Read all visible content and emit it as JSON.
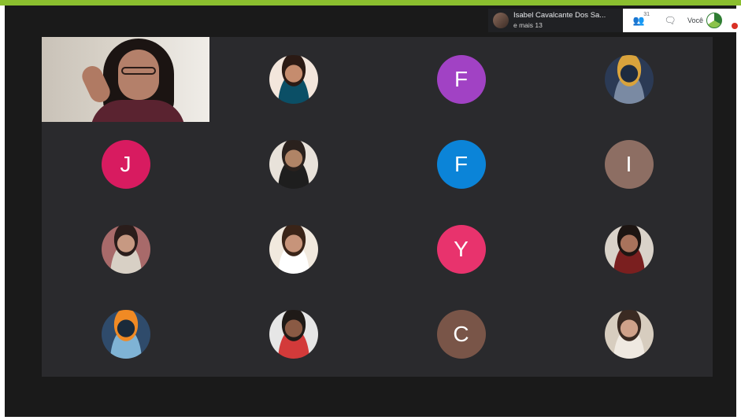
{
  "header": {
    "presenter_name": "Isabel Cavalcante Dos Sa...",
    "presenter_more": "e mais 13",
    "participants_count": "31",
    "you_label": "Você"
  },
  "participants": [
    {
      "type": "video",
      "name": "Presenter video"
    },
    {
      "type": "photo"
    },
    {
      "type": "initial",
      "letter": "F",
      "color": "#a142c4"
    },
    {
      "type": "photo"
    },
    {
      "type": "initial",
      "letter": "J",
      "color": "#d81b60"
    },
    {
      "type": "photo"
    },
    {
      "type": "initial",
      "letter": "F",
      "color": "#0b84d8"
    },
    {
      "type": "initial",
      "letter": "I",
      "color": "#8d6e63"
    },
    {
      "type": "photo"
    },
    {
      "type": "photo"
    },
    {
      "type": "initial",
      "letter": "Y",
      "color": "#e8336d"
    },
    {
      "type": "photo"
    },
    {
      "type": "photo"
    },
    {
      "type": "photo"
    },
    {
      "type": "initial",
      "letter": "C",
      "color": "#795548"
    },
    {
      "type": "photo"
    }
  ],
  "colors": {
    "accent": "#8bbf2f",
    "background": "#1a1a1a",
    "grid": "#2a2a2d"
  }
}
